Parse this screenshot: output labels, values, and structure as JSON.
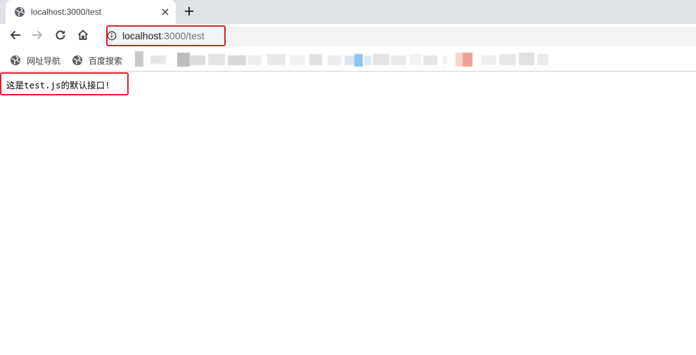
{
  "tab": {
    "title": "localhost:3000/test",
    "favicon": "globe-icon",
    "close": "close-icon"
  },
  "new_tab": "plus-icon",
  "toolbar": {
    "back": "arrow-left-icon",
    "forward": "arrow-right-icon",
    "reload": "reload-icon",
    "home": "home-icon"
  },
  "address_bar": {
    "info": "info-icon",
    "host": "localhost",
    "rest": ":3000/test"
  },
  "bookmarks": [
    {
      "label": "网址导航",
      "icon": "globe-icon"
    },
    {
      "label": "百度搜索",
      "icon": "globe-icon"
    }
  ],
  "page": {
    "message": "这是test.js的默认接口!"
  },
  "colors": {
    "highlight": "#e0202c",
    "tabstrip": "#dee1e6",
    "omnibox": "#f1f3f4"
  }
}
